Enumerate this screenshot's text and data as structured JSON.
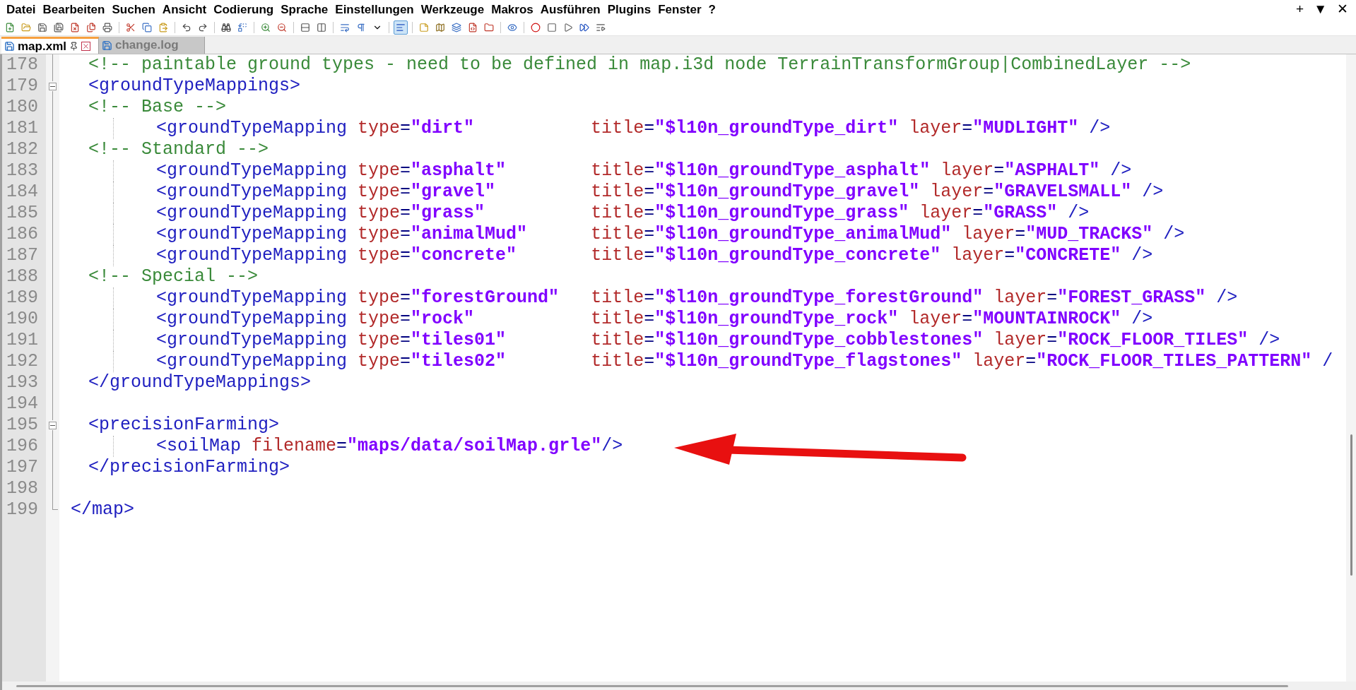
{
  "menu": [
    "Datei",
    "Bearbeiten",
    "Suchen",
    "Ansicht",
    "Codierung",
    "Sprache",
    "Einstellungen",
    "Werkzeuge",
    "Makros",
    "Ausführen",
    "Plugins",
    "Fenster",
    "?"
  ],
  "window_controls": [
    "+",
    "▼",
    "✕"
  ],
  "toolbar": [
    {
      "selected": false
    },
    {
      "selected": false
    },
    {
      "selected": false
    },
    {
      "selected": false
    },
    {
      "selected": false
    },
    {
      "selected": false
    },
    {
      "selected": false
    },
    {
      "selected": false
    },
    {
      "selected": false
    },
    {
      "selected": false
    },
    {
      "selected": false
    },
    {
      "selected": false
    },
    {
      "selected": false
    },
    {
      "selected": false
    },
    {
      "selected": false
    },
    {
      "selected": false
    },
    {
      "selected": false
    },
    {
      "selected": false
    },
    {
      "selected": false
    },
    {
      "selected": false
    },
    {
      "selected": false
    },
    {
      "selected": true
    },
    {
      "selected": false
    },
    {
      "selected": false
    },
    {
      "selected": false
    },
    {
      "selected": false
    },
    {
      "selected": false
    },
    {
      "selected": false
    },
    {
      "selected": false
    },
    {
      "selected": false
    },
    {
      "selected": false
    },
    {
      "selected": false
    },
    {
      "selected": false
    }
  ],
  "tabs": [
    {
      "label": "map.xml",
      "selected": true
    },
    {
      "label": "change.log",
      "selected": false
    }
  ],
  "editor": {
    "lines": [
      {
        "number": "178",
        "segments": [
          {
            "kind": "comment",
            "text": "<!-- paintable ground types - need to be defined in map.i3d node TerrainTransformGroup|CombinedLayer -->"
          }
        ]
      },
      {
        "number": "179",
        "expanded": true,
        "segments": [
          {
            "kind": "tag",
            "text": "<groundTypeMappings>"
          }
        ]
      },
      {
        "number": "180",
        "segments": [
          {
            "kind": "comment",
            "text": "<!-- Base -->"
          }
        ],
        "children": [
          {
            "number": "181",
            "segments": [
              {
                "kind": "tag",
                "text": "<groundTypeMapping"
              },
              {
                "kind": "attr",
                "text": " type"
              },
              {
                "kind": "sym",
                "text": "="
              },
              {
                "kind": "value",
                "text": "\"dirt\""
              },
              {
                "kind": "attr",
                "text": "           title"
              },
              {
                "kind": "sym",
                "text": "="
              },
              {
                "kind": "value",
                "text": "\"$l10n_groundType_dirt\""
              },
              {
                "kind": "attr",
                "text": " layer"
              },
              {
                "kind": "sym",
                "text": "="
              },
              {
                "kind": "value",
                "text": "\"MUDLIGHT\""
              },
              {
                "kind": "tag",
                "text": " />"
              }
            ]
          }
        ]
      },
      {
        "number": "182",
        "segments": [
          {
            "kind": "comment",
            "text": "<!-- Standard -->"
          }
        ],
        "children": [
          {
            "number": "183",
            "segments": [
              {
                "kind": "tag",
                "text": "<groundTypeMapping"
              },
              {
                "kind": "attr",
                "text": " type"
              },
              {
                "kind": "sym",
                "text": "="
              },
              {
                "kind": "value",
                "text": "\"asphalt\""
              },
              {
                "kind": "attr",
                "text": "        title"
              },
              {
                "kind": "sym",
                "text": "="
              },
              {
                "kind": "value",
                "text": "\"$l10n_groundType_asphalt\""
              },
              {
                "kind": "attr",
                "text": " layer"
              },
              {
                "kind": "sym",
                "text": "="
              },
              {
                "kind": "value",
                "text": "\"ASPHALT\""
              },
              {
                "kind": "tag",
                "text": " />"
              }
            ]
          },
          {
            "number": "184",
            "segments": [
              {
                "kind": "tag",
                "text": "<groundTypeMapping"
              },
              {
                "kind": "attr",
                "text": " type"
              },
              {
                "kind": "sym",
                "text": "="
              },
              {
                "kind": "value",
                "text": "\"gravel\""
              },
              {
                "kind": "attr",
                "text": "         title"
              },
              {
                "kind": "sym",
                "text": "="
              },
              {
                "kind": "value",
                "text": "\"$l10n_groundType_gravel\""
              },
              {
                "kind": "attr",
                "text": " layer"
              },
              {
                "kind": "sym",
                "text": "="
              },
              {
                "kind": "value",
                "text": "\"GRAVELSMALL\""
              },
              {
                "kind": "tag",
                "text": " />"
              }
            ]
          },
          {
            "number": "185",
            "segments": [
              {
                "kind": "tag",
                "text": "<groundTypeMapping"
              },
              {
                "kind": "attr",
                "text": " type"
              },
              {
                "kind": "sym",
                "text": "="
              },
              {
                "kind": "value",
                "text": "\"grass\""
              },
              {
                "kind": "attr",
                "text": "          title"
              },
              {
                "kind": "sym",
                "text": "="
              },
              {
                "kind": "value",
                "text": "\"$l10n_groundType_grass\""
              },
              {
                "kind": "attr",
                "text": " layer"
              },
              {
                "kind": "sym",
                "text": "="
              },
              {
                "kind": "value",
                "text": "\"GRASS\""
              },
              {
                "kind": "tag",
                "text": " />"
              }
            ]
          },
          {
            "number": "186",
            "segments": [
              {
                "kind": "tag",
                "text": "<groundTypeMapping"
              },
              {
                "kind": "attr",
                "text": " type"
              },
              {
                "kind": "sym",
                "text": "="
              },
              {
                "kind": "value",
                "text": "\"animalMud\""
              },
              {
                "kind": "attr",
                "text": "      title"
              },
              {
                "kind": "sym",
                "text": "="
              },
              {
                "kind": "value",
                "text": "\"$l10n_groundType_animalMud\""
              },
              {
                "kind": "attr",
                "text": " layer"
              },
              {
                "kind": "sym",
                "text": "="
              },
              {
                "kind": "value",
                "text": "\"MUD_TRACKS\""
              },
              {
                "kind": "tag",
                "text": " />"
              }
            ]
          },
          {
            "number": "187",
            "segments": [
              {
                "kind": "tag",
                "text": "<groundTypeMapping"
              },
              {
                "kind": "attr",
                "text": " type"
              },
              {
                "kind": "sym",
                "text": "="
              },
              {
                "kind": "value",
                "text": "\"concrete\""
              },
              {
                "kind": "attr",
                "text": "       title"
              },
              {
                "kind": "sym",
                "text": "="
              },
              {
                "kind": "value",
                "text": "\"$l10n_groundType_concrete\""
              },
              {
                "kind": "attr",
                "text": " layer"
              },
              {
                "kind": "sym",
                "text": "="
              },
              {
                "kind": "value",
                "text": "\"CONCRETE\""
              },
              {
                "kind": "tag",
                "text": " />"
              }
            ]
          }
        ]
      },
      {
        "number": "188",
        "segments": [
          {
            "kind": "comment",
            "text": "<!-- Special -->"
          }
        ],
        "children": [
          {
            "number": "189",
            "segments": [
              {
                "kind": "tag",
                "text": "<groundTypeMapping"
              },
              {
                "kind": "attr",
                "text": " type"
              },
              {
                "kind": "sym",
                "text": "="
              },
              {
                "kind": "value",
                "text": "\"forestGround\""
              },
              {
                "kind": "attr",
                "text": "   title"
              },
              {
                "kind": "sym",
                "text": "="
              },
              {
                "kind": "value",
                "text": "\"$l10n_groundType_forestGround\""
              },
              {
                "kind": "attr",
                "text": " layer"
              },
              {
                "kind": "sym",
                "text": "="
              },
              {
                "kind": "value",
                "text": "\"FOREST_GRASS\""
              },
              {
                "kind": "tag",
                "text": " />"
              }
            ]
          },
          {
            "number": "190",
            "segments": [
              {
                "kind": "tag",
                "text": "<groundTypeMapping"
              },
              {
                "kind": "attr",
                "text": " type"
              },
              {
                "kind": "sym",
                "text": "="
              },
              {
                "kind": "value",
                "text": "\"rock\""
              },
              {
                "kind": "attr",
                "text": "           title"
              },
              {
                "kind": "sym",
                "text": "="
              },
              {
                "kind": "value",
                "text": "\"$l10n_groundType_rock\""
              },
              {
                "kind": "attr",
                "text": " layer"
              },
              {
                "kind": "sym",
                "text": "="
              },
              {
                "kind": "value",
                "text": "\"MOUNTAINROCK\""
              },
              {
                "kind": "tag",
                "text": " />"
              }
            ]
          },
          {
            "number": "191",
            "segments": [
              {
                "kind": "tag",
                "text": "<groundTypeMapping"
              },
              {
                "kind": "attr",
                "text": " type"
              },
              {
                "kind": "sym",
                "text": "="
              },
              {
                "kind": "value",
                "text": "\"tiles01\""
              },
              {
                "kind": "attr",
                "text": "        title"
              },
              {
                "kind": "sym",
                "text": "="
              },
              {
                "kind": "value",
                "text": "\"$l10n_groundType_cobblestones\""
              },
              {
                "kind": "attr",
                "text": " layer"
              },
              {
                "kind": "sym",
                "text": "="
              },
              {
                "kind": "value",
                "text": "\"ROCK_FLOOR_TILES\""
              },
              {
                "kind": "tag",
                "text": " />"
              }
            ]
          },
          {
            "number": "192",
            "segments": [
              {
                "kind": "tag",
                "text": "<groundTypeMapping"
              },
              {
                "kind": "attr",
                "text": " type"
              },
              {
                "kind": "sym",
                "text": "="
              },
              {
                "kind": "value",
                "text": "\"tiles02\""
              },
              {
                "kind": "attr",
                "text": "        title"
              },
              {
                "kind": "sym",
                "text": "="
              },
              {
                "kind": "value",
                "text": "\"$l10n_groundType_flagstones\""
              },
              {
                "kind": "attr",
                "text": " layer"
              },
              {
                "kind": "sym",
                "text": "="
              },
              {
                "kind": "value",
                "text": "\"ROCK_FLOOR_TILES_PATTERN\""
              },
              {
                "kind": "tag",
                "text": " /"
              }
            ]
          }
        ]
      },
      {
        "number": "193",
        "segments": [
          {
            "kind": "tag",
            "text": "</groundTypeMappings>"
          }
        ]
      },
      {
        "number": "194"
      },
      {
        "number": "195",
        "expanded": true,
        "segments": [
          {
            "kind": "tag",
            "text": "<precisionFarming>"
          }
        ],
        "children": [
          {
            "number": "196",
            "segments": [
              {
                "kind": "tag",
                "text": "<soilMap"
              },
              {
                "kind": "attr",
                "text": " filename"
              },
              {
                "kind": "sym",
                "text": "="
              },
              {
                "kind": "value",
                "text": "\"maps/data/soilMap.grle\""
              },
              {
                "kind": "tag",
                "text": "/>"
              }
            ]
          }
        ]
      },
      {
        "number": "197",
        "segments": [
          {
            "kind": "tag",
            "text": "</precisionFarming>"
          }
        ]
      },
      {
        "number": "198"
      }
    ],
    "end_line": {
      "number": "199",
      "segments": [
        {
          "kind": "tag",
          "text": "</map>"
        }
      ]
    }
  }
}
